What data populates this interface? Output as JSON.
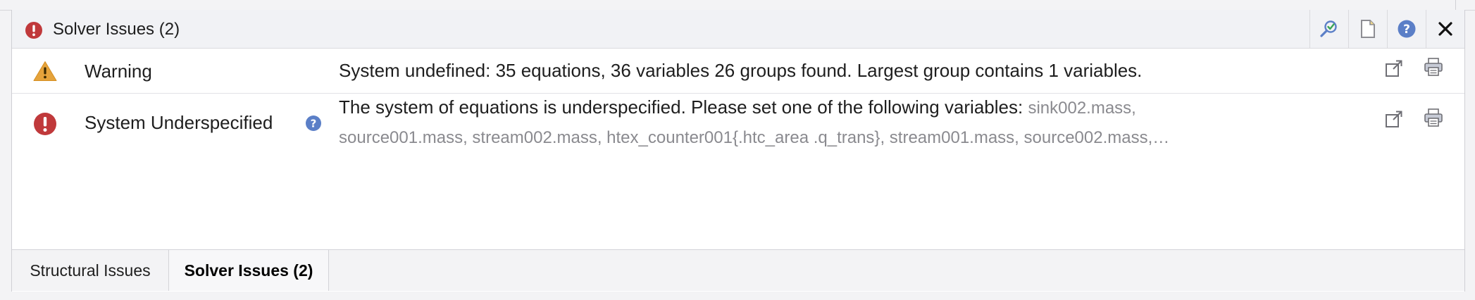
{
  "panel": {
    "title": "Solver Issues (2)"
  },
  "header_buttons": [
    {
      "icon": "search-check-icon"
    },
    {
      "icon": "document-icon"
    },
    {
      "icon": "help-icon"
    },
    {
      "icon": "close-icon"
    }
  ],
  "issues": [
    {
      "severity": "Warning",
      "message": "System undefined: 35 equations, 36 variables 26 groups found. Largest group contains 1 variables.",
      "icon": "warning-triangle-icon",
      "color": "#e5a33b"
    },
    {
      "severity": "System Underspecified",
      "message_line1": "The system of equations is underspecified. Please set one of the following variables: ",
      "vars_line1": "sink002.mass,",
      "vars_line2": "source001.mass, stream002.mass, htex_counter001{.htc_area .q_trans}, stream001.mass, source002.mass,…",
      "icon": "error-circle-icon",
      "color": "#c0393b"
    }
  ],
  "tabs": [
    {
      "label": "Structural Issues",
      "active": false
    },
    {
      "label": "Solver Issues (2)",
      "active": true
    }
  ],
  "colors": {
    "error": "#c0393b",
    "warning": "#e5a33b",
    "help": "#5b7fc7"
  }
}
